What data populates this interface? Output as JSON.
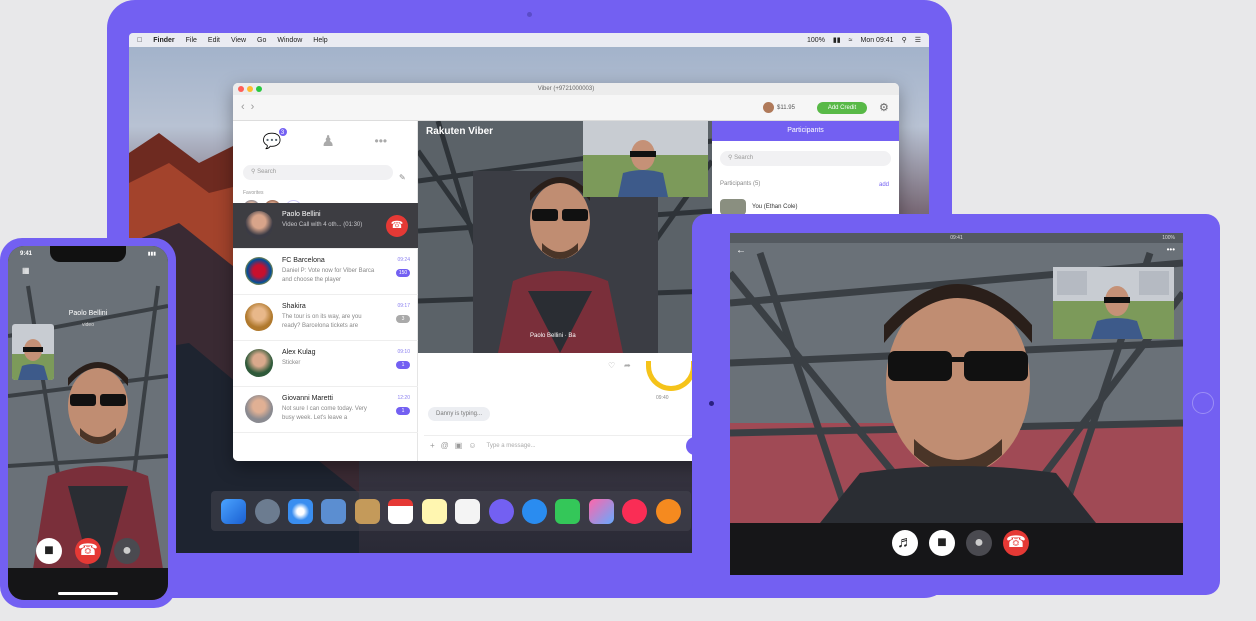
{
  "mac_menubar": {
    "items": [
      "Finder",
      "File",
      "Edit",
      "View",
      "Go",
      "Window",
      "Help"
    ],
    "battery": "100%",
    "clock": "Mon 09:41"
  },
  "viber_window": {
    "title": "Viber (+9721000003)",
    "balance": "$11.95",
    "add_credit_label": "Add Credit",
    "chat_list": {
      "search_placeholder": "Search",
      "favorites_label": "Favorites",
      "unread_badge": "3",
      "chats": [
        {
          "name": "Paolo Bellini",
          "message": "Video Call with 4 oth... (01:30)",
          "time": "",
          "count": ""
        },
        {
          "name": "FC Barcelona",
          "message": "Daniel P: Vote now for Viber Barca and choose the player",
          "time": "09:24",
          "count": "150"
        },
        {
          "name": "Shakira",
          "message": "The tour is on its way, are you ready? Barcelona tickets are",
          "time": "09:17",
          "count": "3"
        },
        {
          "name": "Alex Kulag",
          "message": "Sticker",
          "time": "09:10",
          "count": "1"
        },
        {
          "name": "Giovanni Maretti",
          "message": "Not sure I can come today. Very busy week. Let's leave a",
          "time": "12:20",
          "count": "1"
        }
      ]
    },
    "video": {
      "brand": "Rakuten Viber",
      "caller_name": "Paolo Bellini",
      "caller_suffix": "Ba"
    },
    "chat": {
      "typing_text": "Danny is typing...",
      "sticker_time": "09:40",
      "input_placeholder": "Type a message..."
    },
    "participants": {
      "header": "Participants",
      "search_placeholder": "Search",
      "count_label": "Participants (5)",
      "add_label": "add",
      "me_label": "You (Ethan Cole)"
    }
  },
  "phone": {
    "time": "9:41",
    "caller_name": "Paolo Bellini",
    "call_status": "video"
  },
  "tablet": {
    "status_time": "09:41",
    "battery": "100%"
  },
  "colors": {
    "viber_purple": "#7360f2",
    "end_call_red": "#e53935",
    "add_credit_green": "#58b947"
  },
  "icons": [
    "apple-icon",
    "chat-icon",
    "contacts-icon",
    "more-icon",
    "search-icon",
    "end-call-icon",
    "video-icon",
    "mute-icon",
    "speaker-icon",
    "send-icon",
    "settings-icon"
  ]
}
